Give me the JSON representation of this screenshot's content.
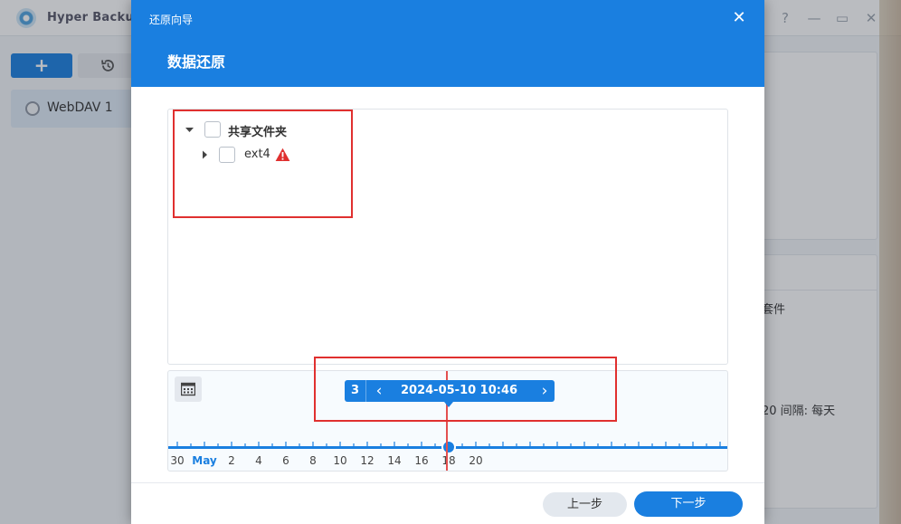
{
  "app": {
    "title": "Hyper Backup",
    "window_controls": {
      "help": "?",
      "minimize": "—",
      "maximize": "▭",
      "close": "✕"
    },
    "toolbar": {
      "add_label": "+",
      "restore_icon": "history-icon"
    },
    "task": {
      "label": "WebDAV 1",
      "icon": "webdav-icon"
    },
    "panel_text_1": "套件",
    "panel_text_2": "20 间隔: 每天"
  },
  "dialog": {
    "title": "还原向导",
    "heading": "数据还原",
    "close_label": "✕",
    "tree": {
      "root": {
        "label": "共享文件夹",
        "expanded": true,
        "checked": false
      },
      "child": {
        "label": "ext4",
        "expanded": false,
        "checked": false,
        "warning_icon": "warning-triangle-icon"
      }
    },
    "timeline": {
      "version_count": "3",
      "prev_label": "‹",
      "next_label": "›",
      "selected_time": "2024-05-10 10:46",
      "month_label": "May",
      "tick_labels": [
        "30",
        "May",
        "2",
        "4",
        "6",
        "8",
        "10",
        "12",
        "14",
        "16",
        "18",
        "20"
      ],
      "accent": "#1a7fe0",
      "marker_color": "#e35050"
    },
    "footer": {
      "prev_label": "上一步",
      "next_label": "下一步"
    }
  },
  "colors": {
    "primary": "#1a7fe0",
    "highlight": "#e0302f"
  }
}
